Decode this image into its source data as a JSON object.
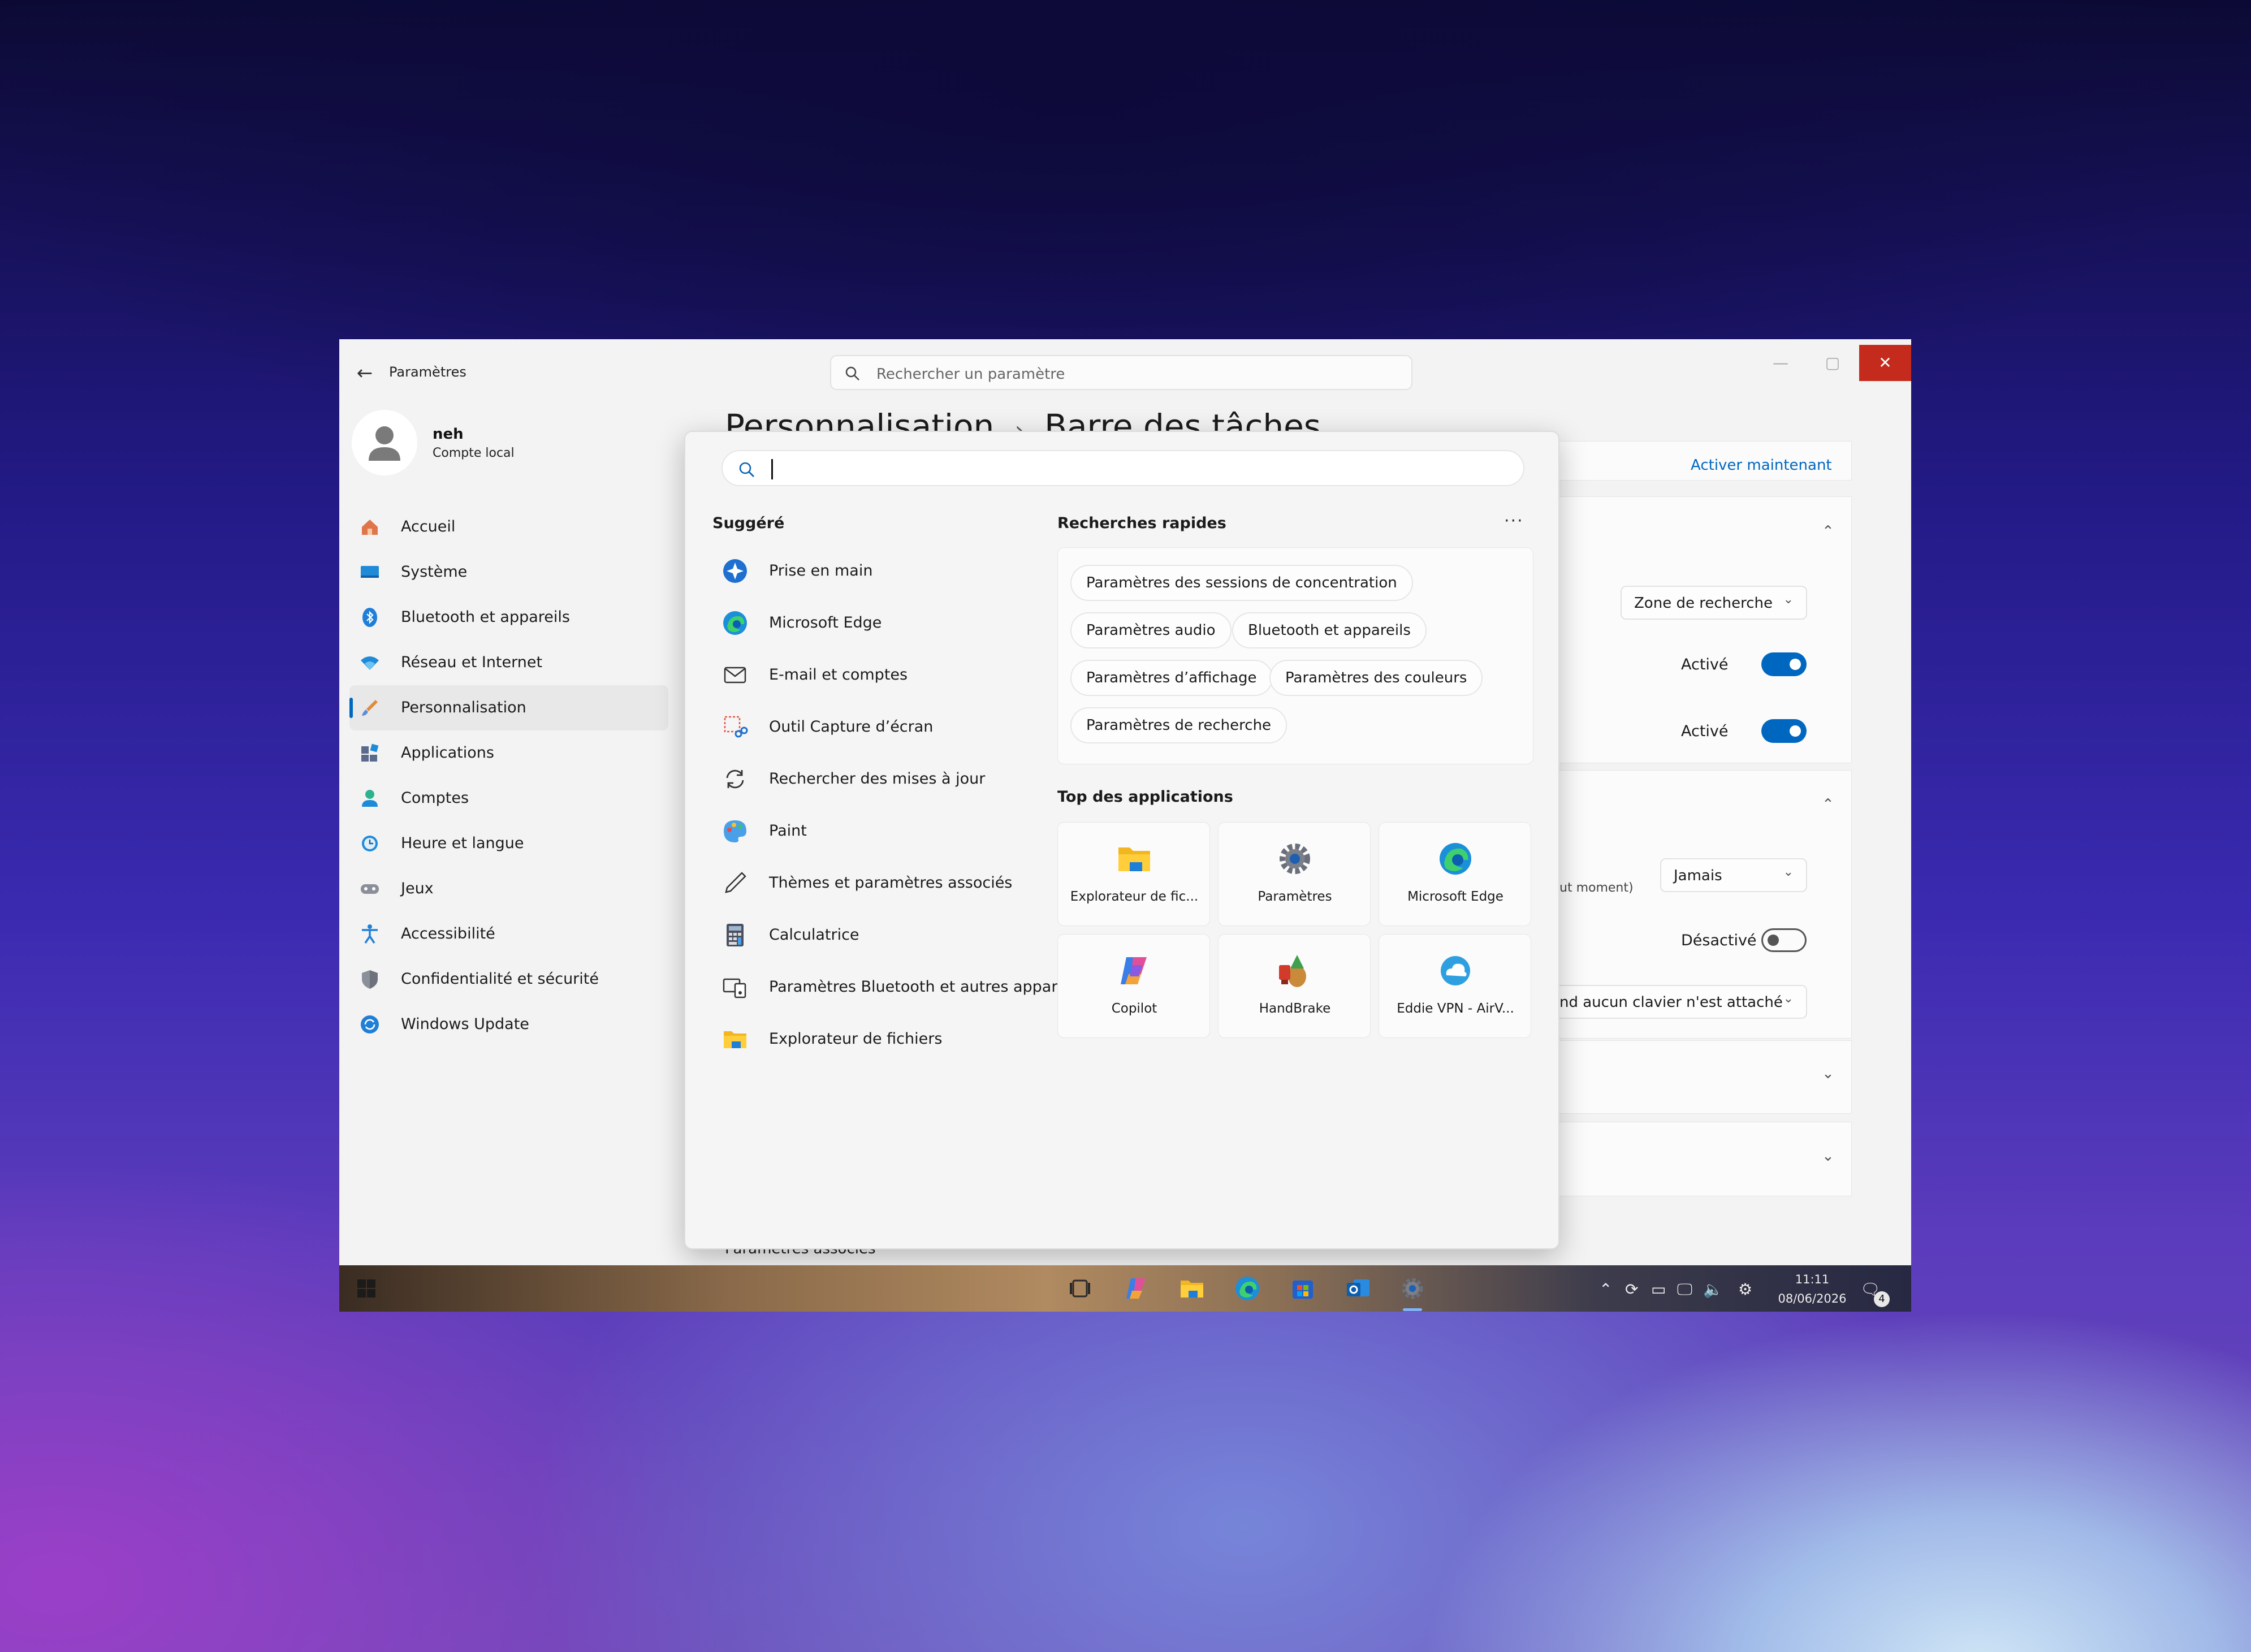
{
  "window": {
    "title": "Paramètres",
    "search_placeholder": "Rechercher un paramètre",
    "minimize": "—",
    "maximize": "▢",
    "close": "✕"
  },
  "profile": {
    "name": "neh",
    "account": "Compte local"
  },
  "nav": [
    {
      "label": "Accueil",
      "icon": "home-icon"
    },
    {
      "label": "Système",
      "icon": "system-icon"
    },
    {
      "label": "Bluetooth et appareils",
      "icon": "bluetooth-icon"
    },
    {
      "label": "Réseau et Internet",
      "icon": "wifi-icon"
    },
    {
      "label": "Personnalisation",
      "icon": "brush-icon",
      "active": true
    },
    {
      "label": "Applications",
      "icon": "apps-icon"
    },
    {
      "label": "Comptes",
      "icon": "account-icon"
    },
    {
      "label": "Heure et langue",
      "icon": "clock-icon"
    },
    {
      "label": "Jeux",
      "icon": "gamepad-icon"
    },
    {
      "label": "Accessibilité",
      "icon": "accessibility-icon"
    },
    {
      "label": "Confidentialité et sécurité",
      "icon": "shield-icon"
    },
    {
      "label": "Windows Update",
      "icon": "update-icon"
    }
  ],
  "page": {
    "breadcrumb_parent": "Personnalisation",
    "breadcrumb_sep": "›",
    "breadcrumb_current": "Barre des tâches"
  },
  "settings": {
    "activer_link": "Activer maintenant",
    "search_combo": "Zone de recherche",
    "toggle1_state": "Activé",
    "toggle2_state": "Activé",
    "partial_text": "ut moment)",
    "jamais_combo": "Jamais",
    "toggle3_state": "Désactivé",
    "keyboard_combo": "nd aucun clavier n'est attaché",
    "related": "Paramètres associés"
  },
  "flyout": {
    "suggested_title": "Suggéré",
    "quick_title": "Recherches rapides",
    "more": "···",
    "top_apps_title": "Top des applications",
    "suggested": [
      {
        "label": "Prise en main",
        "icon": "get-started-icon"
      },
      {
        "label": "Microsoft Edge",
        "icon": "edge-icon"
      },
      {
        "label": "E-mail et comptes",
        "icon": "mail-icon"
      },
      {
        "label": "Outil Capture d’écran",
        "icon": "snipping-tool-icon"
      },
      {
        "label": "Rechercher des mises à jour",
        "icon": "refresh-icon"
      },
      {
        "label": "Paint",
        "icon": "paint-icon"
      },
      {
        "label": "Thèmes et paramètres associés",
        "icon": "pen-icon"
      },
      {
        "label": "Calculatrice",
        "icon": "calculator-icon"
      },
      {
        "label": "Paramètres Bluetooth et autres appareils",
        "icon": "devices-icon"
      },
      {
        "label": "Explorateur de fichiers",
        "icon": "folder-icon"
      }
    ],
    "quick_searches": [
      "Paramètres des sessions de concentration",
      "Paramètres audio",
      "Bluetooth et appareils",
      "Paramètres d’affichage",
      "Paramètres des couleurs",
      "Paramètres de recherche"
    ],
    "top_apps": [
      {
        "label": "Explorateur de fic...",
        "icon": "folder-icon"
      },
      {
        "label": "Paramètres",
        "icon": "gear-icon"
      },
      {
        "label": "Microsoft Edge",
        "icon": "edge-icon"
      },
      {
        "label": "Copilot",
        "icon": "copilot-icon"
      },
      {
        "label": "HandBrake",
        "icon": "handbrake-icon"
      },
      {
        "label": "Eddie VPN - AirV...",
        "icon": "vpn-icon"
      }
    ]
  },
  "taskbar": {
    "time": "11:11",
    "date": "08/06/2026",
    "notification_count": "4"
  }
}
